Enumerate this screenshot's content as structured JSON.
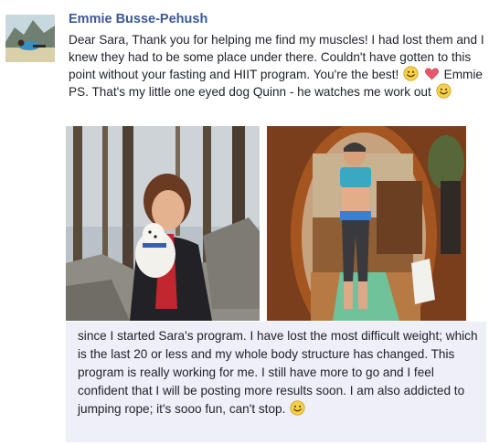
{
  "post": {
    "author_name": "Emmie Busse-Pehush",
    "comment_part1": "Dear Sara, Thank you for helping me find my muscles! I had lost them and I knew they had to be some place under there. Couldn't have gotten to this point without your fasting and HIIT program. You're the best!",
    "comment_part2": "Emmie PS. That's my little one eyed dog Quinn - he watches me work out",
    "followup_text": "since I started Sara's program. I have lost the most difficult weight; which is the last 20 or less and my whole body structure has changed. This program is really working for me. I still have more to go and I feel confident that I will be posting more results soon. I am also addicted to jumping rope; it's sooo fun, can't stop."
  },
  "icons": {
    "smiley": "smiley-emoji-icon",
    "heart": "red-heart-emoji-icon"
  },
  "colors": {
    "author_link": "#3b5998",
    "followup_bg": "#eff0f7",
    "smiley_fill": "#f7d14a",
    "heart_fill": "#e9586a"
  }
}
